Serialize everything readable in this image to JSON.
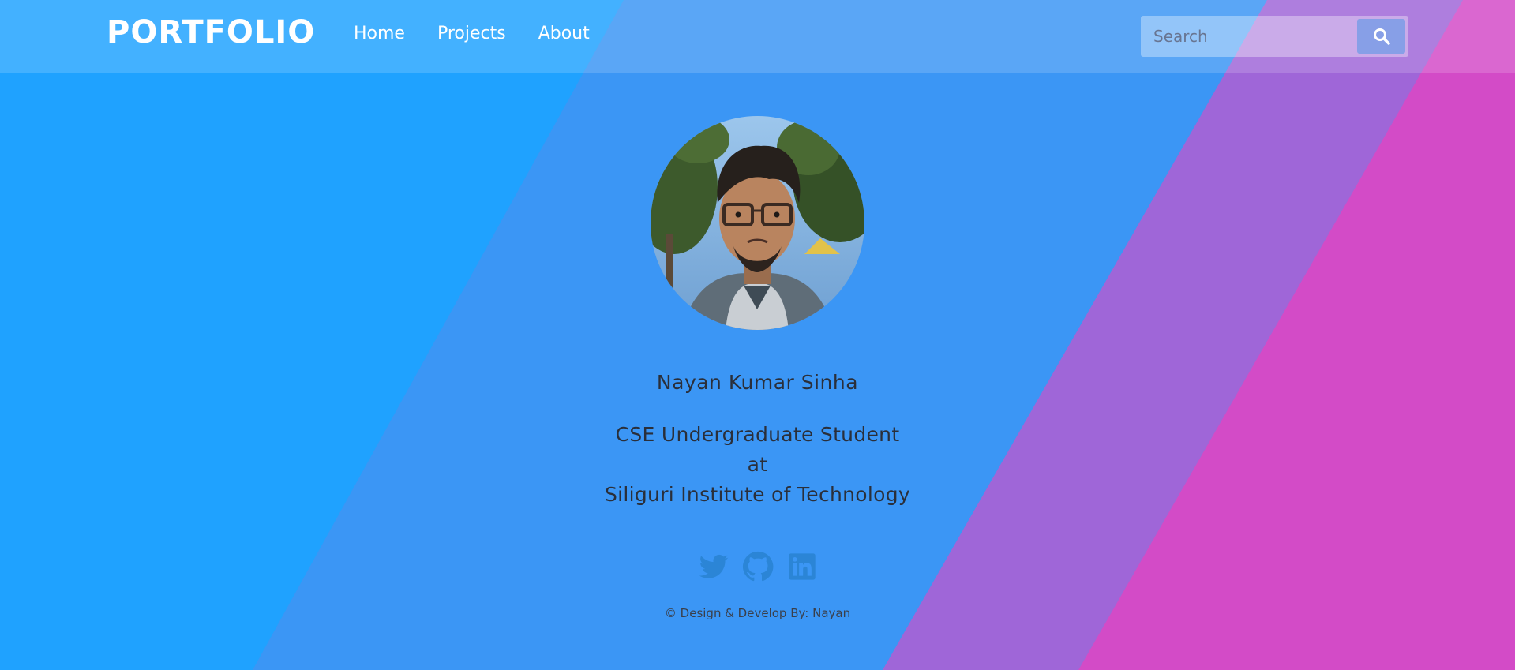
{
  "colors": {
    "background_blue": "#1fa2ff",
    "band_blue": "#3b96f5",
    "band_purple": "#9f66d8",
    "band_pink": "#d34bc7",
    "text_dark": "#2a2f3a",
    "icon_blue": "#2b85d6"
  },
  "navbar": {
    "brand": "PORTFOLIO",
    "links": [
      {
        "label": "Home"
      },
      {
        "label": "Projects"
      },
      {
        "label": "About"
      }
    ],
    "search": {
      "placeholder": "Search",
      "button_icon": "search-icon"
    }
  },
  "profile": {
    "avatar_icon": "profile-photo",
    "name": "Nayan Kumar Sinha",
    "role_line1": "CSE Undergraduate Student",
    "role_line2": "at",
    "role_line3": "Siliguri Institute of Technology"
  },
  "social": [
    {
      "icon": "twitter-icon"
    },
    {
      "icon": "github-icon"
    },
    {
      "icon": "linkedin-icon"
    }
  ],
  "footer": {
    "text": "© Design & Develop By: Nayan"
  }
}
